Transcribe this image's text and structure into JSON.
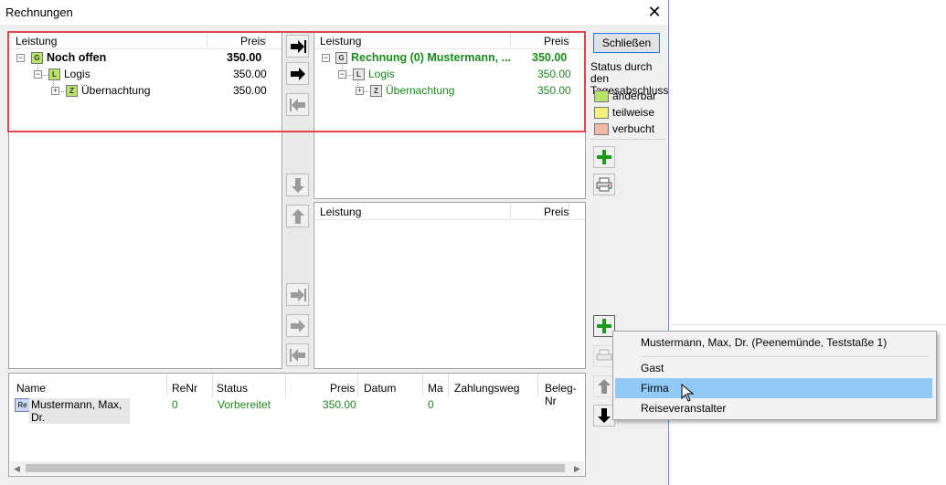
{
  "window": {
    "title": "Rechnungen",
    "close_glyph": "✕"
  },
  "left_panel": {
    "headers": {
      "leistung": "Leistung",
      "preis": "Preis"
    },
    "rows": [
      {
        "badge": "G",
        "label": "Noch offen",
        "price": "350.00"
      },
      {
        "badge": "L",
        "label": "Logis",
        "price": "350.00"
      },
      {
        "badge": "Z",
        "label": "Übernachtung",
        "price": "350.00"
      }
    ]
  },
  "right_top_panel": {
    "headers": {
      "leistung": "Leistung",
      "preis": "Preis"
    },
    "rows": [
      {
        "badge": "G",
        "label": "Rechnung (0) Mustermann, ...",
        "price": "350.00"
      },
      {
        "badge": "L",
        "label": "Logis",
        "price": "350.00"
      },
      {
        "badge": "Z",
        "label": "Übernachtung",
        "price": "350.00"
      }
    ]
  },
  "right_bottom_panel": {
    "headers": {
      "leistung": "Leistung",
      "preis": "Preis"
    }
  },
  "sidebar": {
    "close_button": "Schließen",
    "status_heading": "Status durch den Tagesabschluss",
    "legend": [
      {
        "label": "änderbar",
        "color": "#b7e36b"
      },
      {
        "label": "teilweise",
        "color": "#f2ef7a"
      },
      {
        "label": "verbucht",
        "color": "#f3b8a8"
      }
    ]
  },
  "bottom_table": {
    "columns": [
      "Name",
      "ReNr",
      "Status",
      "Preis",
      "Datum",
      "Ma",
      "Zahlungsweg",
      "Beleg-Nr"
    ],
    "rows": [
      {
        "badge": "Re",
        "name": "Mustermann, Max, Dr.",
        "renr": "0",
        "status": "Vorbereitet",
        "preis": "350.00",
        "datum": "",
        "ma": "0",
        "zahlungsweg": "",
        "beleg": ""
      }
    ]
  },
  "context_menu": {
    "items": [
      "Mustermann, Max, Dr. (Peenemünde, Teststaße 1)",
      "Gast",
      "Firma",
      "Reiseveranstalter"
    ],
    "highlighted": "Firma"
  },
  "colors": {
    "accent_green": "#1a8a1a",
    "highlight_box": "#e0474c",
    "menu_highlight": "#91c9f7"
  }
}
